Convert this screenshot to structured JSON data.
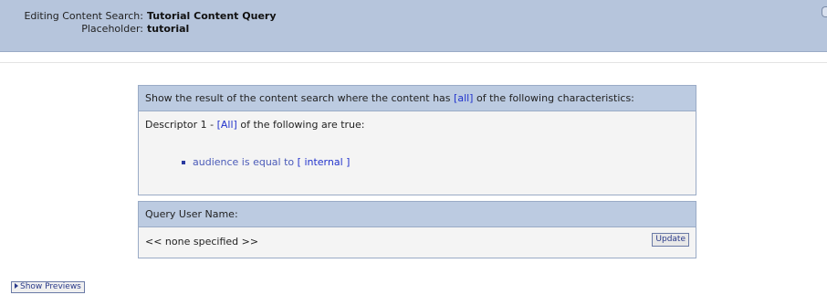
{
  "header": {
    "search_label": "Editing Content Search:",
    "search_value": "Tutorial Content Query",
    "placeholder_label": "Placeholder:",
    "placeholder_value": "tutorial"
  },
  "criteria": {
    "intro_prefix": "Show the result of the content search where the content has",
    "match_all": "[all]",
    "intro_suffix": "of the following characteristics:",
    "descriptor_prefix": "Descriptor 1 -",
    "descriptor_all": "[All]",
    "descriptor_suffix": "of the following are true:",
    "condition_text": "audience is equal to",
    "condition_value": "[ internal ]"
  },
  "query_user": {
    "title": "Query User Name:",
    "value": "<< none specified >>",
    "update_label": "Update"
  },
  "show_previews_label": "Show Previews"
}
